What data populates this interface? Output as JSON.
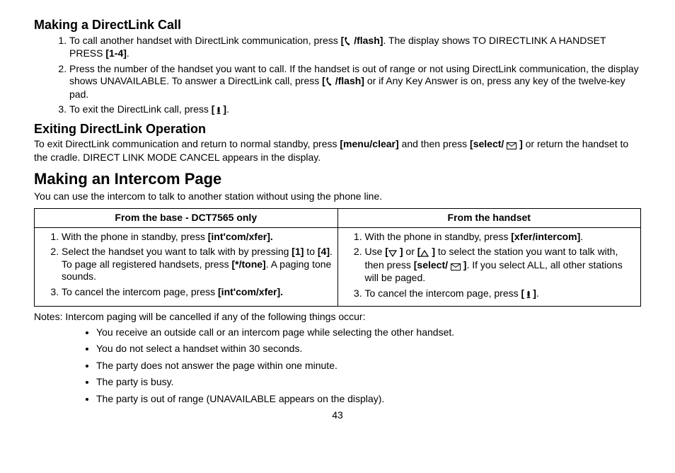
{
  "section1": {
    "title": "Making a DirectLink Call",
    "steps": [
      {
        "pre": "To call another handset with DirectLink communication, press ",
        "b1_open": "[",
        "icon1": "phone",
        "b1_close": " /flash]",
        "post1": ". The display shows TO DIRECTLINK A HANDSET PRESS ",
        "b2": "[1-4]",
        "post2": "."
      },
      {
        "pre": "Press the number of the handset you want to call. If the handset is out of range or not using DirectLink communication, the display shows UNAVAILABLE. To answer a DirectLink call, press ",
        "b1_open": "[",
        "icon1": "phone",
        "b1_close": " /flash]",
        "post1": " or if Any Key Answer is on, press any key of the twelve-key pad."
      },
      {
        "pre": "To exit the DirectLink call, press ",
        "b1_open": "[",
        "icon1": "handset-end",
        "b1_close": "]",
        "post1": "."
      }
    ]
  },
  "section2": {
    "title": "Exiting DirectLink Operation",
    "para_pre": "To exit DirectLink communication and return to normal standby, press ",
    "b1": "[menu/clear]",
    "mid": " and then press ",
    "b2_open": "[select/ ",
    "icon": "envelope",
    "b2_close": " ]",
    "post": " or return the handset to the cradle. DIRECT LINK MODE CANCEL appears in the display."
  },
  "section3": {
    "title": "Making an Intercom Page",
    "intro": "You can use the intercom to talk to another station without using the phone line.",
    "table": {
      "head_left": "From the base - DCT7565 only",
      "head_right": "From the handset",
      "left": [
        {
          "pre": "With the phone in standby, press ",
          "b1": "[int'com/xfer].",
          "post": ""
        },
        {
          "pre": "Select the handset you want to talk with by pressing ",
          "b1": "[1]",
          "mid1": " to ",
          "b2": "[4]",
          "mid2": ". To page all registered handsets, press ",
          "b3": "[*/tone]",
          "post": ". A paging tone sounds."
        },
        {
          "pre": "To cancel the intercom page, press ",
          "b1": "[int'com/xfer].",
          "post": ""
        }
      ],
      "right": [
        {
          "pre": "With the phone in standby, press ",
          "b1": "[xfer/intercom]",
          "post": "."
        },
        {
          "pre": "Use ",
          "br_open1": "[",
          "icon1": "down-tri",
          "br_close1": " ]",
          "mid1": " or ",
          "br_open2": "[",
          "icon2": "up-tri",
          "br_close2": " ]",
          "mid2": " to select the station you want to talk with, then press ",
          "b_sel_open": "[select/ ",
          "icon3": "envelope",
          "b_sel_close": " ]",
          "post": ". If you select ALL, all other stations will be paged."
        },
        {
          "pre": "To cancel the intercom page, press ",
          "br_open": "[",
          "icon": "handset-end",
          "br_close": "]",
          "post": "."
        }
      ]
    },
    "notes_label": "Notes: ",
    "notes_intro": "Intercom paging will be cancelled if any of the following things occur:",
    "notes": [
      "You receive an outside call or an intercom page while selecting the other handset.",
      "You do not select a handset within 30 seconds.",
      "The party does not answer the page within one minute.",
      "The party is busy.",
      "The party is out of range (UNAVAILABLE appears on the display)."
    ]
  },
  "page_number": "43",
  "icons": {
    "phone": "phone-icon",
    "handset-end": "handset-end-icon",
    "envelope": "envelope-icon",
    "down-tri": "down-triangle-icon",
    "up-tri": "up-triangle-icon"
  }
}
